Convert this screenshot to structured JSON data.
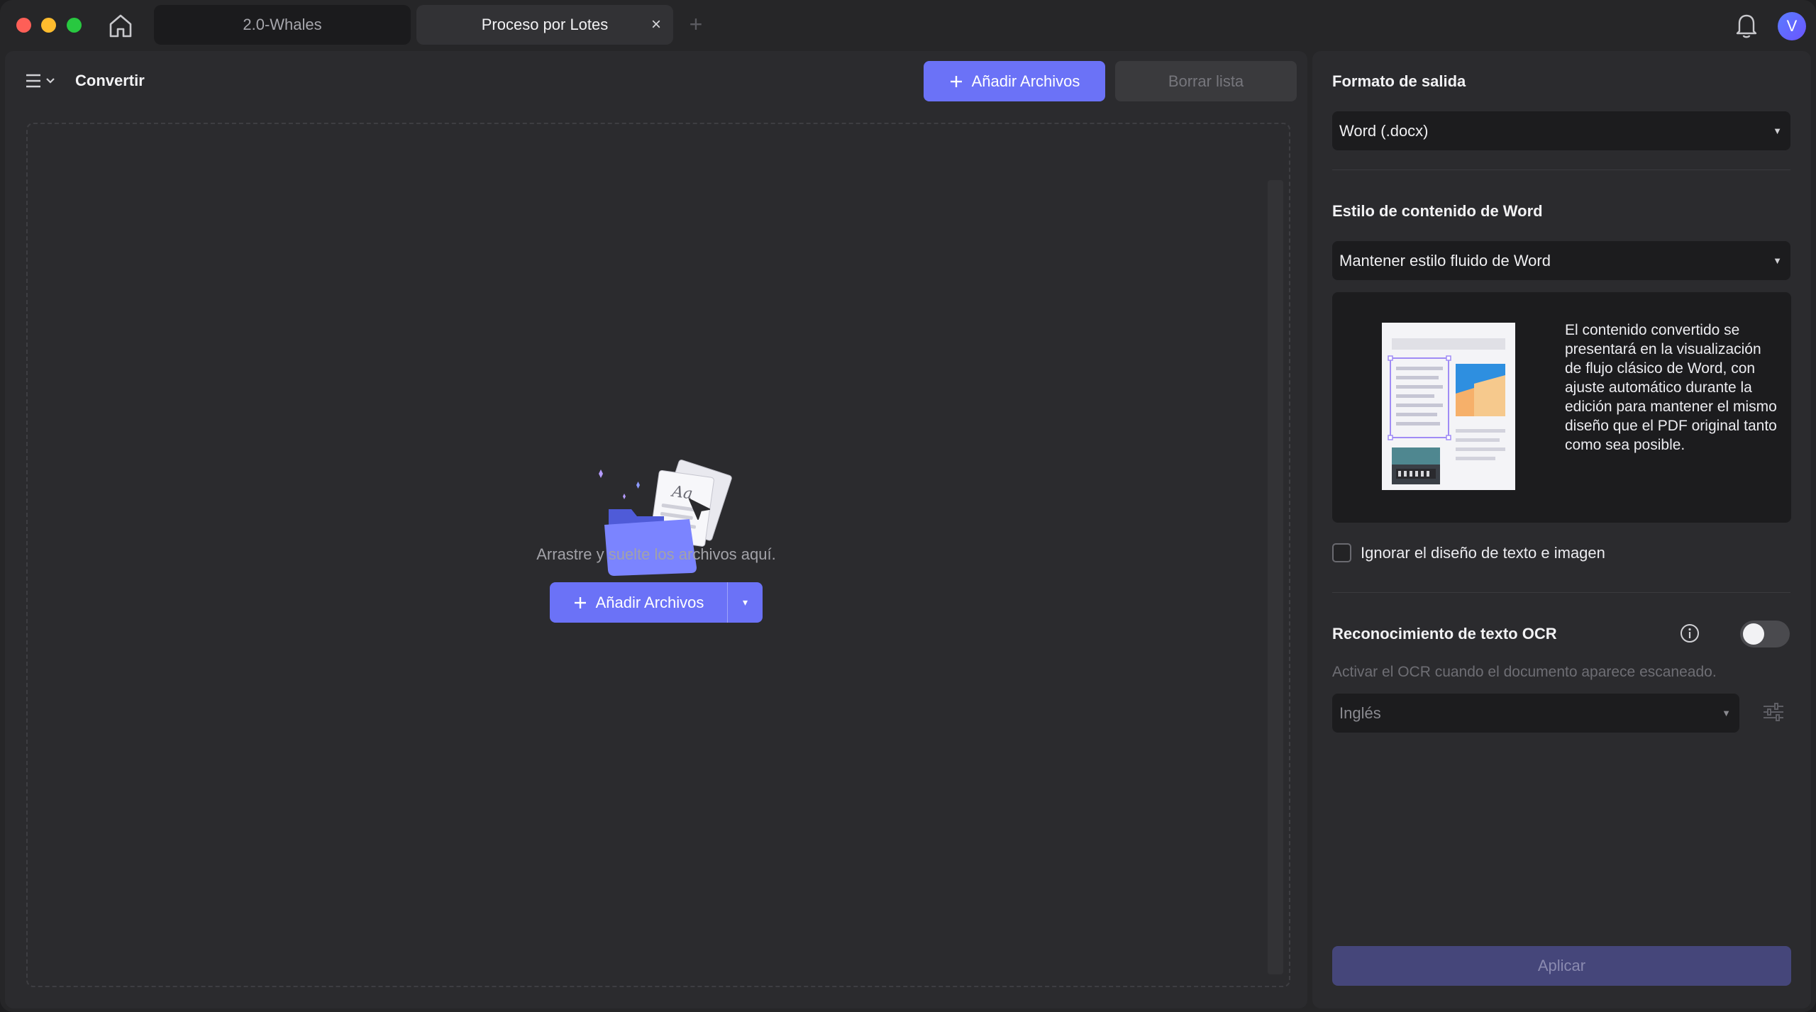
{
  "tabs": [
    {
      "label": "2.0-Whales"
    },
    {
      "label": "Proceso por Lotes",
      "close_glyph": "×"
    }
  ],
  "new_tab_glyph": "+",
  "avatar_initial": "V",
  "toolbar": {
    "title": "Convertir",
    "add_files_label": "Añadir Archivos",
    "clear_list_label": "Borrar lista"
  },
  "dropzone": {
    "hint": "Arrastre y suelte los archivos aquí.",
    "add_files_label": "Añadir Archivos",
    "dropdown_glyph": "▾"
  },
  "settings": {
    "output_format_label": "Formato de salida",
    "output_format_value": "Word (.docx)",
    "word_style_label": "Estilo de contenido de Word",
    "word_style_value": "Mantener estilo fluido de Word",
    "preview_description": "El contenido convertido se presentará en la visualización de flujo clásico de Word, con ajuste automático durante la edición para mantener el mismo diseño que el PDF original tanto como sea posible.",
    "ignore_layout_label": "Ignorar el diseño de texto e imagen",
    "ignore_layout_checked": false,
    "ocr_label": "Reconocimiento de texto OCR",
    "ocr_enabled": false,
    "ocr_hint": "Activar el OCR cuando el documento aparece escaneado.",
    "ocr_language": "Inglés",
    "apply_label": "Aplicar"
  },
  "colors": {
    "accent": "#6b72f7",
    "apply_disabled": "#45467a"
  }
}
